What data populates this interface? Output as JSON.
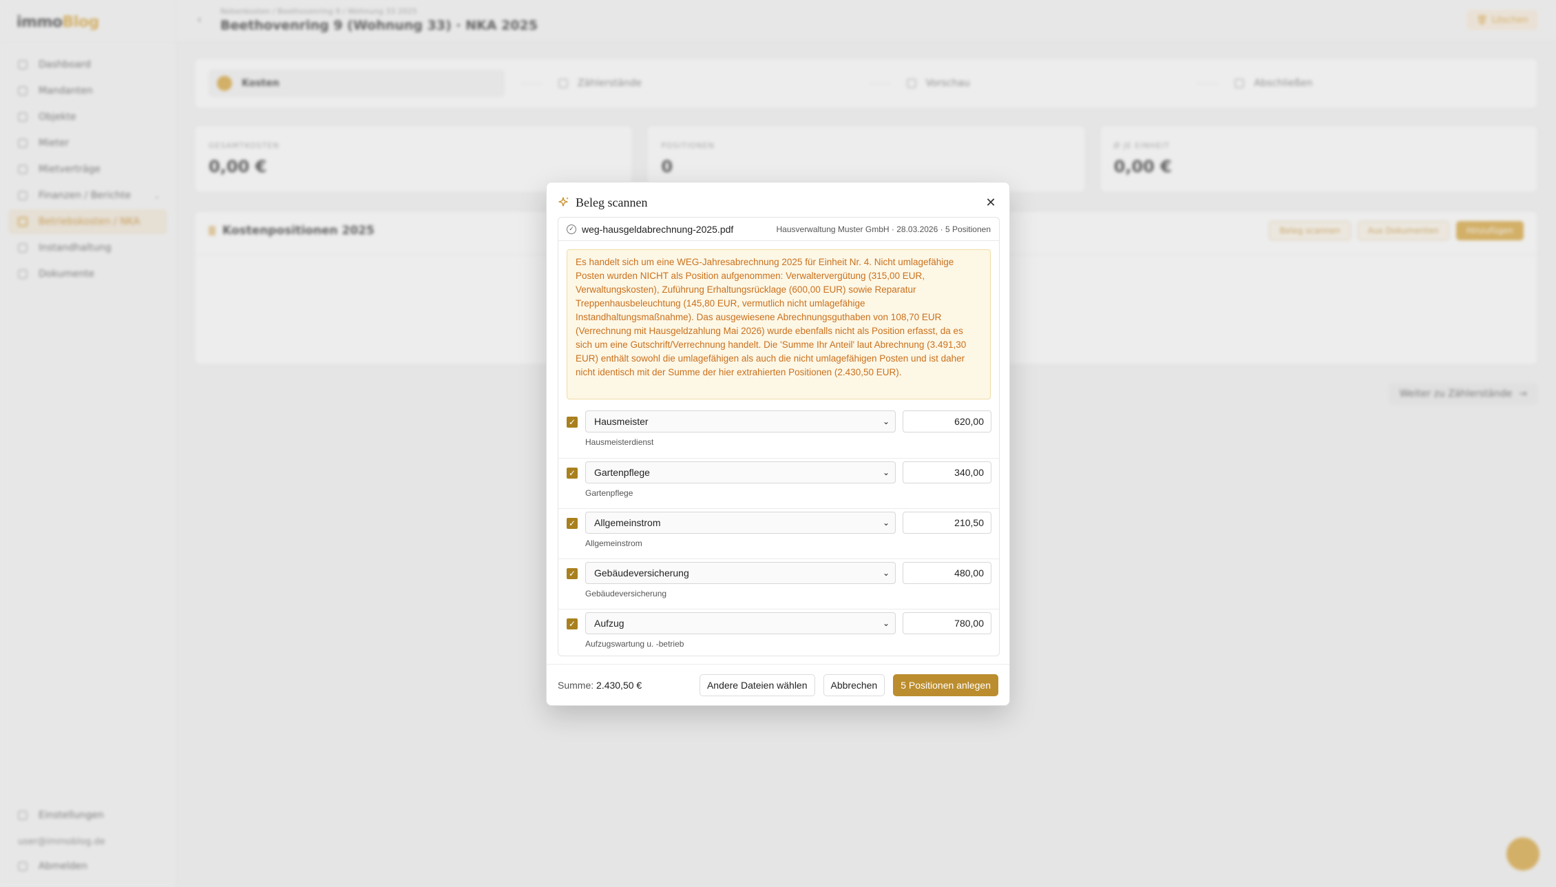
{
  "sidebar": {
    "logo_main": "immo",
    "logo_accent": "Blog",
    "items": [
      {
        "label": "Dashboard"
      },
      {
        "label": "Mandanten"
      },
      {
        "label": "Objekte"
      },
      {
        "label": "Mieter"
      },
      {
        "label": "Mietverträge"
      },
      {
        "label": "Finanzen / Berichte"
      },
      {
        "label": "Betriebskosten / NKA"
      },
      {
        "label": "Instandhaltung"
      },
      {
        "label": "Dokumente"
      }
    ],
    "bottom": {
      "settings": "Einstellungen",
      "email": "user@immoblog.de",
      "logout": "Abmelden"
    }
  },
  "header": {
    "breadcrumb": "Nebenkosten / Beethovenring 9 / Wohnung 33 2025",
    "title": "Beethovenring 9 (Wohnung 33) · NKA 2025",
    "delete_label": "Löschen"
  },
  "stepper": {
    "steps": [
      {
        "label": "Kosten"
      },
      {
        "label": "Zählerstände"
      },
      {
        "label": "Vorschau"
      },
      {
        "label": "Abschließen"
      }
    ]
  },
  "stats": [
    {
      "label": "GESAMTKOSTEN",
      "value": "0,00 €"
    },
    {
      "label": "POSITIONEN",
      "value": "0"
    },
    {
      "label": "Ø JE EINHEIT",
      "value": "0,00 €"
    }
  ],
  "costs": {
    "title": "Kostenpositionen 2025",
    "btn_scan": "Beleg scannen",
    "btn_docs": "Aus Dokumenten",
    "btn_add": "Hinzufügen",
    "next": "Weiter zu Zählerstände"
  },
  "modal": {
    "title": "Beleg scannen",
    "file_name": "weg-hausgeldabrechnung-2025.pdf",
    "file_meta": "Hausverwaltung Muster GmbH · 28.03.2026 · 5 Positionen",
    "note": "Es handelt sich um eine WEG-Jahresabrechnung 2025 für Einheit Nr. 4. Nicht umlagefähige Posten wurden NICHT als Position aufgenommen: Verwaltervergütung (315,00 EUR, Verwaltungskosten), Zuführung Erhaltungsrücklage (600,00 EUR) sowie Reparatur Treppenhausbeleuchtung (145,80 EUR, vermutlich nicht umlagefähige Instandhaltungsmaßnahme). Das ausgewiesene Abrechnungsguthaben von 108,70 EUR (Verrechnung mit Hausgeldzahlung Mai 2026) wurde ebenfalls nicht als Position erfasst, da es sich um eine Gutschrift/Verrechnung handelt. Die 'Summe Ihr Anteil' laut Abrechnung (3.491,30 EUR) enthält sowohl die umlagefähigen als auch die nicht umlagefähigen Posten und ist daher nicht identisch mit der Summe der hier extrahierten Positionen (2.430,50 EUR).",
    "positions": [
      {
        "category": "Hausmeister",
        "amount": "620,00",
        "description": "Hausmeisterdienst",
        "checked": true
      },
      {
        "category": "Gartenpflege",
        "amount": "340,00",
        "description": "Gartenpflege",
        "checked": true
      },
      {
        "category": "Allgemeinstrom",
        "amount": "210,50",
        "description": "Allgemeinstrom",
        "checked": true
      },
      {
        "category": "Gebäudeversicherung",
        "amount": "480,00",
        "description": "Gebäudeversicherung",
        "checked": true
      },
      {
        "category": "Aufzug",
        "amount": "780,00",
        "description": "Aufzugswartung u. -betrieb",
        "checked": true
      }
    ],
    "sum_label": "Summe:",
    "sum_value": "2.430,50 €",
    "btn_other": "Andere Dateien wählen",
    "btn_cancel": "Abbrechen",
    "btn_create": "5 Positionen anlegen"
  },
  "colors": {
    "accent": "#d9a53a",
    "primary_button": "#bb8d2e",
    "note_bg": "#fdf7e6",
    "note_text": "#c9711d",
    "checkbox": "#a9801e"
  }
}
